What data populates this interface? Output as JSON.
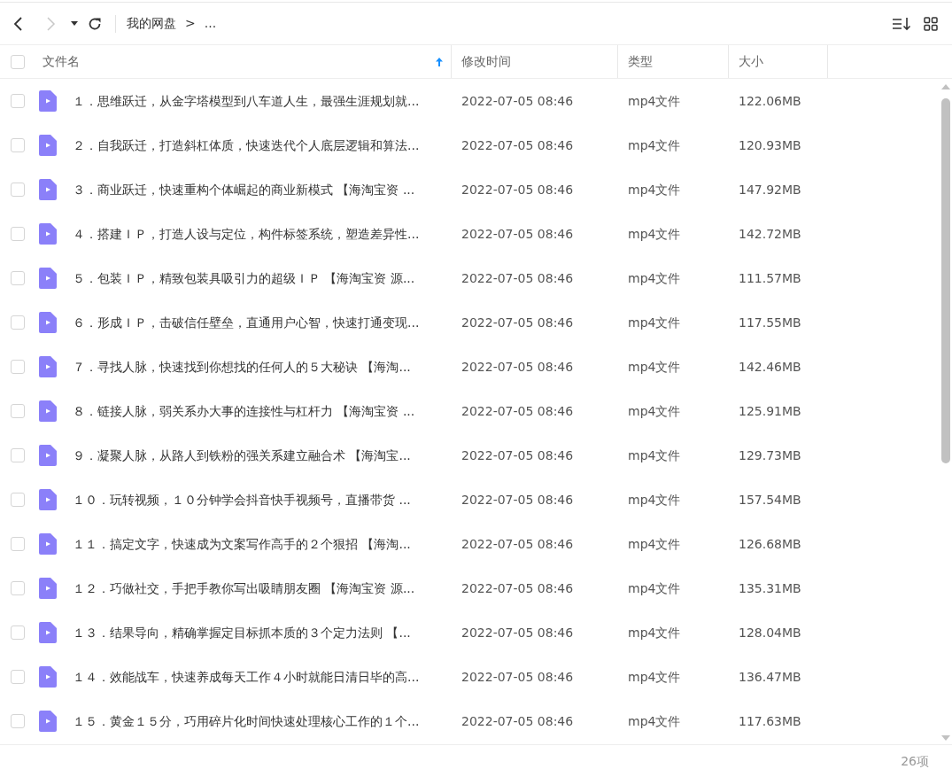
{
  "toolbar": {
    "breadcrumb": [
      "我的网盘",
      "..."
    ],
    "separator": ">"
  },
  "table": {
    "select_all": {
      "checked": false
    },
    "columns": [
      {
        "label": "文件名",
        "sorted": true
      },
      {
        "label": "修改时间",
        "sorted": false
      },
      {
        "label": "类型",
        "sorted": false
      },
      {
        "label": "大小",
        "sorted": false
      }
    ],
    "rows": [
      {
        "checked": false,
        "name": "１．思维跃迁，从金字塔模型到八车道人生，最强生涯规划就...",
        "modified": "2022-07-05 08:46",
        "type": "mp4文件",
        "size": "122.06MB"
      },
      {
        "checked": false,
        "name": "２．自我跃迁，打造斜杠体质，快速迭代个人底层逻辑和算法...",
        "modified": "2022-07-05 08:46",
        "type": "mp4文件",
        "size": "120.93MB"
      },
      {
        "checked": false,
        "name": "３．商业跃迁，快速重构个体崛起的商业新模式 【海淘宝资 ...",
        "modified": "2022-07-05 08:46",
        "type": "mp4文件",
        "size": "147.92MB"
      },
      {
        "checked": false,
        "name": "４．搭建ＩＰ，打造人设与定位，构件标签系统，塑造差异性...",
        "modified": "2022-07-05 08:46",
        "type": "mp4文件",
        "size": "142.72MB"
      },
      {
        "checked": false,
        "name": "５．包装ＩＰ，精致包装具吸引力的超级ＩＰ 【海淘宝资 源...",
        "modified": "2022-07-05 08:46",
        "type": "mp4文件",
        "size": "111.57MB"
      },
      {
        "checked": false,
        "name": "６．形成ＩＰ，击破信任壁垒，直通用户心智，快速打通变现...",
        "modified": "2022-07-05 08:46",
        "type": "mp4文件",
        "size": "117.55MB"
      },
      {
        "checked": false,
        "name": "７．寻找人脉，快速找到你想找的任何人的５大秘诀 【海淘...",
        "modified": "2022-07-05 08:46",
        "type": "mp4文件",
        "size": "142.46MB"
      },
      {
        "checked": false,
        "name": "８．链接人脉，弱关系办大事的连接性与杠杆力 【海淘宝资 ...",
        "modified": "2022-07-05 08:46",
        "type": "mp4文件",
        "size": "125.91MB"
      },
      {
        "checked": false,
        "name": "９．凝聚人脉，从路人到铁粉的强关系建立融合术 【海淘宝...",
        "modified": "2022-07-05 08:46",
        "type": "mp4文件",
        "size": "129.73MB"
      },
      {
        "checked": false,
        "name": "１０．玩转视频，１０分钟学会抖音快手视频号，直播带货 ...",
        "modified": "2022-07-05 08:46",
        "type": "mp4文件",
        "size": "157.54MB"
      },
      {
        "checked": false,
        "name": "１１．搞定文字，快速成为文案写作高手的２个狠招 【海淘...",
        "modified": "2022-07-05 08:46",
        "type": "mp4文件",
        "size": "126.68MB"
      },
      {
        "checked": false,
        "name": "１２．巧做社交，手把手教你写出吸睛朋友圈 【海淘宝资 源...",
        "modified": "2022-07-05 08:46",
        "type": "mp4文件",
        "size": "135.31MB"
      },
      {
        "checked": false,
        "name": "１３．结果导向，精确掌握定目标抓本质的３个定力法则 【...",
        "modified": "2022-07-05 08:46",
        "type": "mp4文件",
        "size": "128.04MB"
      },
      {
        "checked": false,
        "name": "１４．效能战车，快速养成每天工作４小时就能日清日毕的高...",
        "modified": "2022-07-05 08:46",
        "type": "mp4文件",
        "size": "136.47MB"
      },
      {
        "checked": false,
        "name": "１５．黄金１５分，巧用碎片化时间快速处理核心工作的１个...",
        "modified": "2022-07-05 08:46",
        "type": "mp4文件",
        "size": "117.63MB"
      }
    ]
  },
  "status_bar": {
    "count": "26项"
  }
}
